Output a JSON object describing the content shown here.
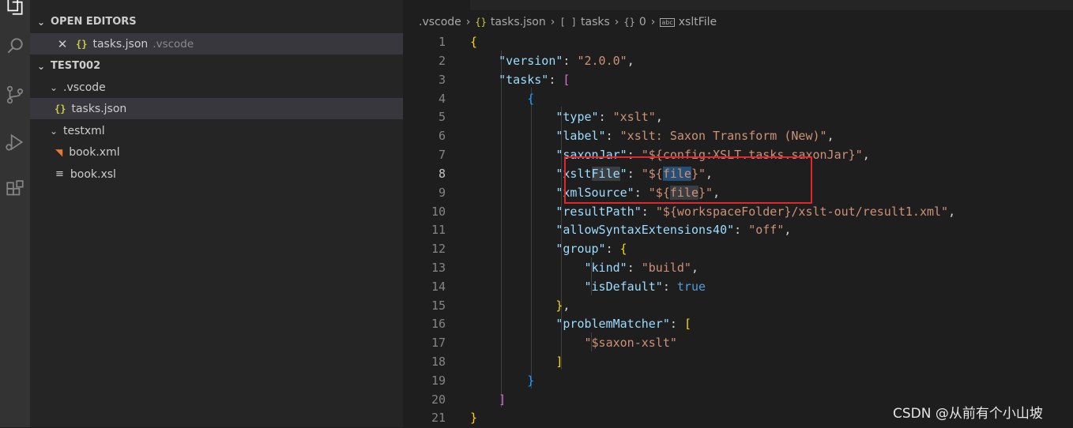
{
  "activity_bar": {
    "icons": [
      "explorer-icon",
      "search-icon",
      "source-control-icon",
      "run-debug-icon",
      "extensions-icon"
    ]
  },
  "sidebar": {
    "open_editors": {
      "header": "OPEN EDITORS",
      "items": [
        {
          "name": "tasks.json",
          "folder": ".vscode"
        }
      ]
    },
    "workspace": {
      "header": "TEST002",
      "tree": [
        {
          "label": ".vscode",
          "type": "folder"
        },
        {
          "label": "tasks.json",
          "type": "json"
        },
        {
          "label": "testxml",
          "type": "folder"
        },
        {
          "label": "book.xml",
          "type": "xml"
        },
        {
          "label": "book.xsl",
          "type": "xsl"
        }
      ]
    }
  },
  "breadcrumb": {
    "items": [
      ".vscode",
      "tasks.json",
      "tasks",
      "0",
      "xsltFile"
    ],
    "icons": {
      "tasks.json": "{}",
      "tasks": "[ ]",
      "0": "{}",
      "xsltFile": "abc"
    }
  },
  "editor": {
    "line_numbers": [
      "1",
      "2",
      "3",
      "4",
      "5",
      "6",
      "7",
      "8",
      "9",
      "10",
      "11",
      "12",
      "13",
      "14",
      "15",
      "16",
      "17",
      "18",
      "19",
      "20",
      "21"
    ],
    "code": {
      "version_key": "\"version\"",
      "version_val": "\"2.0.0\"",
      "tasks_key": "\"tasks\"",
      "type_key": "\"type\"",
      "type_val": "\"xslt\"",
      "label_key": "\"label\"",
      "label_val": "\"xslt: Saxon Transform (New)\"",
      "saxonjar_key": "\"saxonJar\"",
      "saxonjar_val": "\"${config:XSLT.tasks.saxonJar}\"",
      "xsltfile_key_a": "\"xslt",
      "xsltfile_key_b": "File",
      "xsltfile_key_c": "\"",
      "xsltfile_val_a": "\"${",
      "xsltfile_val_b": "file",
      "xsltfile_val_c": "}\"",
      "xmlsource_key": "\"xmlSource\"",
      "xmlsource_val_a": "\"${",
      "xmlsource_val_b": "file",
      "xmlsource_val_c": "}\"",
      "resultpath_key": "\"resultPath\"",
      "resultpath_val": "\"${workspaceFolder}/xslt-out/result1.xml\"",
      "allowsyntax_key": "\"allowSyntaxExtensions40\"",
      "allowsyntax_val": "\"off\"",
      "group_key": "\"group\"",
      "kind_key": "\"kind\"",
      "kind_val": "\"build\"",
      "isdefault_key": "\"isDefault\"",
      "isdefault_val": "true",
      "problemmatcher_key": "\"problemMatcher\"",
      "problemmatcher_val": "\"$saxon-xslt\""
    },
    "highlight_box_color": "#e0282c"
  },
  "watermark": "CSDN @从前有个小山坡"
}
